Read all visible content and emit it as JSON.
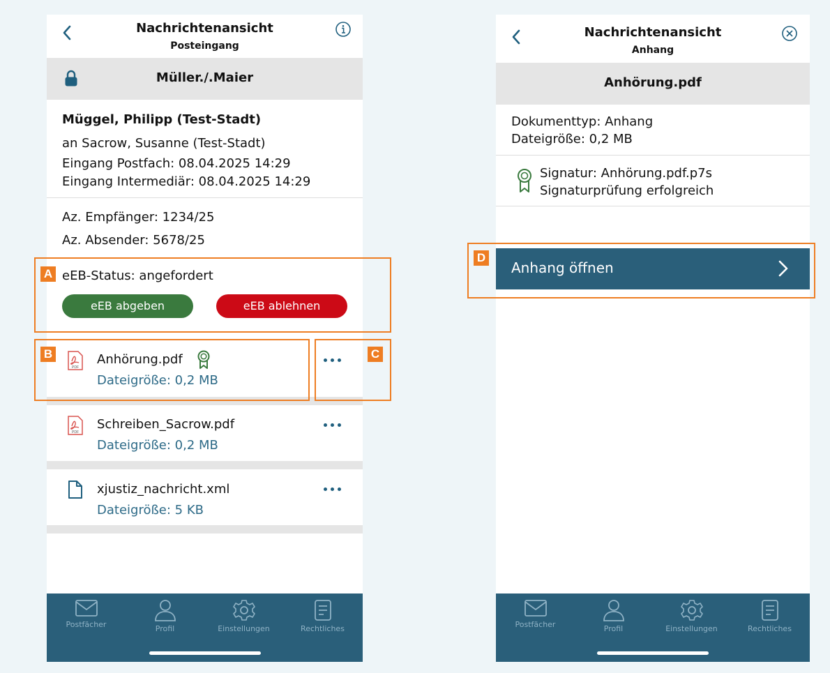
{
  "left_screen": {
    "nav": {
      "title": "Nachrichtenansicht",
      "subtitle": "Posteingang"
    },
    "case_header": "Müller./.Maier",
    "sender": "Müggel, Philipp (Test-Stadt)",
    "recipient": "an Sacrow, Susanne (Test-Stadt)",
    "received_mailbox": "Eingang Postfach: 08.04.2025 14:29",
    "received_intermediary": "Eingang Intermediär: 08.04.2025 14:29",
    "ref_recipient": "Az. Empfänger: 1234/25",
    "ref_sender": "Az. Absender: 5678/25",
    "eeb_status": "eEB-Status: angefordert",
    "eeb_submit_label": "eEB abgeben",
    "eeb_reject_label": "eEB ablehnen",
    "attachments": [
      {
        "name": "Anhörung.pdf",
        "size": "Dateigröße: 0,2 MB",
        "icon": "pdf-icon",
        "signed": true
      },
      {
        "name": "Schreiben_Sacrow.pdf",
        "size": "Dateigröße: 0,2 MB",
        "icon": "pdf-icon",
        "signed": false
      },
      {
        "name": "xjustiz_nachricht.xml",
        "size": "Dateigröße: 5 KB",
        "icon": "file-icon",
        "signed": false
      }
    ]
  },
  "right_screen": {
    "nav": {
      "title": "Nachrichtenansicht",
      "subtitle": "Anhang"
    },
    "file_header": "Anhörung.pdf",
    "doc_type": "Dokumenttyp: Anhang",
    "file_size": "Dateigröße: 0,2 MB",
    "signature": "Signatur: Anhörung.pdf.p7s",
    "signature_check": "Signaturprüfung erfolgreich",
    "open_button_label": "Anhang öffnen"
  },
  "tabbar": {
    "items": [
      {
        "label": "Postfächer",
        "icon": "envelope-icon"
      },
      {
        "label": "Profil",
        "icon": "person-icon"
      },
      {
        "label": "Einstellungen",
        "icon": "gear-icon"
      },
      {
        "label": "Rechtliches",
        "icon": "document-icon"
      }
    ]
  },
  "callouts": {
    "a": "A",
    "b": "B",
    "c": "C",
    "d": "D"
  },
  "colors": {
    "accent": "#2a5f7a",
    "link_text": "#2d6a87",
    "submit_green": "#3a7a3e",
    "reject_red": "#cc0a16",
    "callout_orange": "#ee7d22",
    "pdf_red": "#d9534f",
    "signature_green": "#3a7a3e"
  }
}
